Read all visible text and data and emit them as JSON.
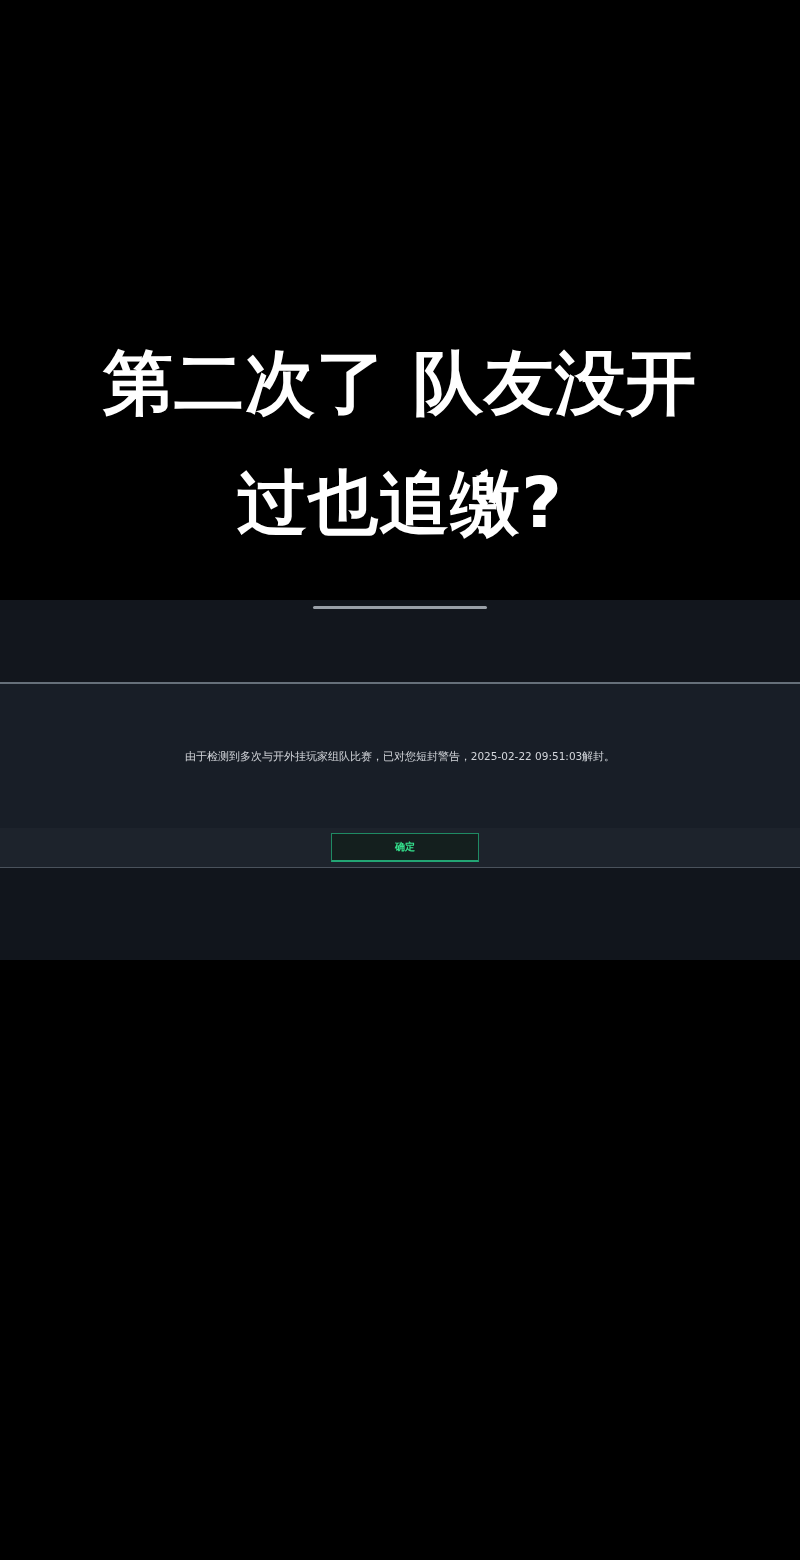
{
  "caption": {
    "lines": [
      "第二次了 队友没开",
      "过也追缴?"
    ]
  },
  "dialog": {
    "message": "由于检测到多次与开外挂玩家组队比赛，已对您短封警告，2025-02-22 09:51:03解封。",
    "confirm_button": {
      "label": "确定"
    }
  }
}
